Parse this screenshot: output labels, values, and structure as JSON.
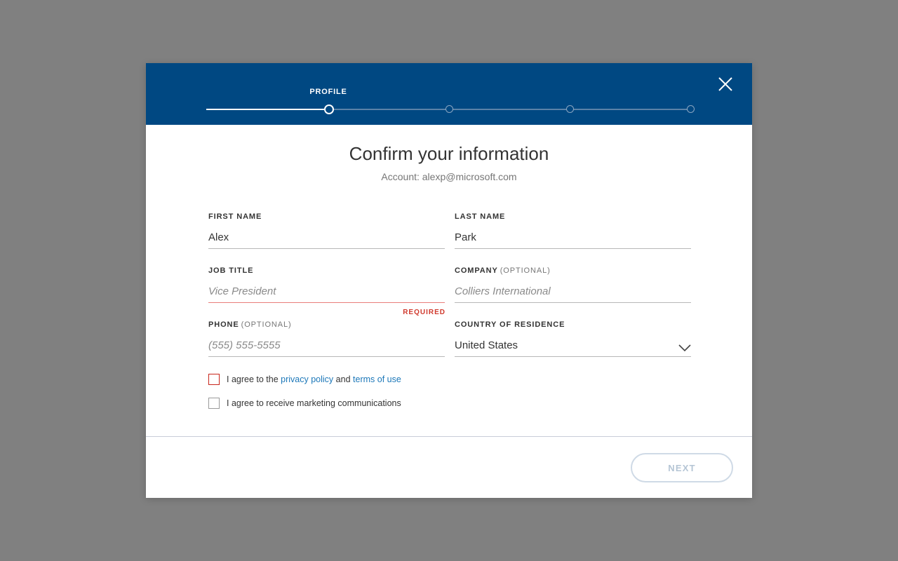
{
  "stepper": {
    "current_label": "PROFILE",
    "step_count": 5,
    "current_step": 1
  },
  "dialog": {
    "title": "Confirm your information",
    "account": "Account: alexp@microsoft.com"
  },
  "form": {
    "first_name": {
      "label": "FIRST NAME",
      "value": "Alex"
    },
    "last_name": {
      "label": "LAST NAME",
      "value": "Park"
    },
    "job_title": {
      "label": "JOB TITLE",
      "placeholder": "Vice President",
      "error": "REQUIRED"
    },
    "company": {
      "label": "COMPANY",
      "optional": "(OPTIONAL)",
      "placeholder": "Colliers International"
    },
    "phone": {
      "label": "PHONE",
      "optional": "(OPTIONAL)",
      "placeholder": "(555) 555-5555"
    },
    "country": {
      "label": "COUNTRY OF RESIDENCE",
      "value": "United States"
    }
  },
  "checkboxes": {
    "privacy": {
      "prefix": "I agree to the",
      "privacy_link": "privacy policy",
      "and": "and",
      "terms_link": "terms of use",
      "checked": false
    },
    "marketing": {
      "label": "I agree to receive marketing communications",
      "checked": false
    }
  },
  "footer": {
    "next_label": "NEXT"
  },
  "colors": {
    "header": "#004882",
    "link": "#1d78b9",
    "error": "#d03a2e",
    "overlay": "#808080"
  },
  "icons": {
    "close": "close-icon",
    "chevron": "chevron-down-icon"
  }
}
